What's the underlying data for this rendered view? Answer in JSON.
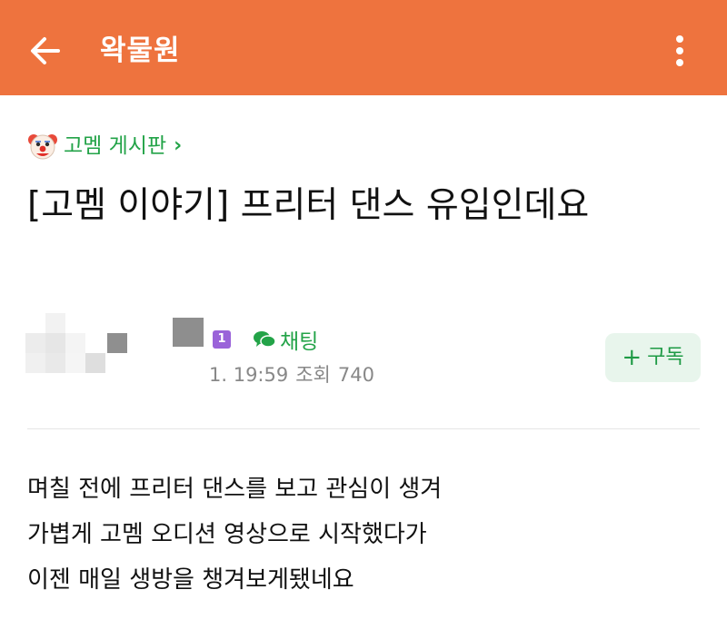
{
  "header": {
    "title": "왁물원",
    "back_icon": "arrow-left-icon",
    "more_icon": "more-vertical-icon",
    "background_color": "#ee733e"
  },
  "board": {
    "icon": "clown-face-icon",
    "name": "고멤 게시판",
    "chevron": "›"
  },
  "post": {
    "title": "[고멤 이야기] 프리터 댄스 유입인데요",
    "author_level": "1",
    "chat_label": "채팅",
    "timestamp": "1. 19:59",
    "views_label": "조회",
    "views_count": "740",
    "body_lines": [
      "며칠 전에 프리터 댄스를 보고 관심이 생겨",
      "가볍게 고멤 오디션 영상으로 시작했다가",
      "이젠 매일 생방을 챙겨보게됐네요"
    ]
  },
  "subscribe": {
    "plus": "+",
    "label": "구독",
    "accent_color": "#1e9a45"
  }
}
